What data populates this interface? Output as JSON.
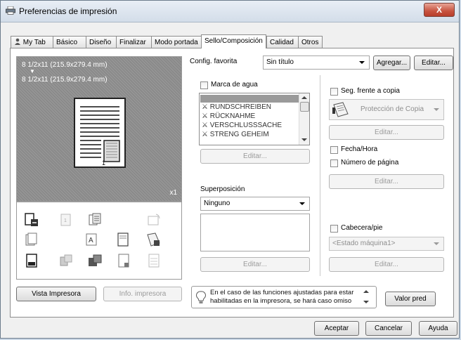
{
  "window": {
    "title": "Preferencias de impresión",
    "close_label": "X"
  },
  "tabs": [
    {
      "label": "My Tab"
    },
    {
      "label": "Básico"
    },
    {
      "label": "Diseño"
    },
    {
      "label": "Finalizar"
    },
    {
      "label": "Modo portada"
    },
    {
      "label": "Sello/Composición"
    },
    {
      "label": "Calidad"
    },
    {
      "label": "Otros"
    }
  ],
  "active_tab": "Sello/Composición",
  "preview": {
    "paper_line1": "8 1/2x11 (215.9x279.4 mm)",
    "arrow": "▼",
    "paper_line2": "8 1/2x11 (215.9x279.4 mm)",
    "copies": "x1",
    "page_badge": "1"
  },
  "left_buttons": {
    "vista": "Vista Impresora",
    "info": "Info. impresora"
  },
  "favorite": {
    "label": "Config. favorita",
    "value": "Sin título",
    "add": "Agregar...",
    "edit": "Editar..."
  },
  "watermark": {
    "label": "Marca de agua",
    "items": [
      "RUNDSCHREIBEN",
      "RÜCKNAHME",
      "VERSCHLUSSSACHE",
      "STRENG GEHEIM"
    ],
    "edit": "Editar..."
  },
  "overlay": {
    "label": "Superposición",
    "value": "Ninguno",
    "edit": "Editar..."
  },
  "copy_security": {
    "label": "Seg. frente a copia",
    "value": "Protección de Copia",
    "edit": "Editar..."
  },
  "datetime": {
    "label": "Fecha/Hora"
  },
  "page_number": {
    "label": "Número de página",
    "edit": "Editar..."
  },
  "header_footer": {
    "label": "Cabecera/pie",
    "value": "<Estado máquina1>",
    "edit": "Editar..."
  },
  "info": {
    "line1": "En el caso de las funciones ajustadas para estar",
    "line2": "habilitadas en la impresora, se hará caso omiso"
  },
  "default_button": "Valor pred",
  "footer": {
    "ok": "Aceptar",
    "cancel": "Cancelar",
    "help": "Ayuda"
  }
}
